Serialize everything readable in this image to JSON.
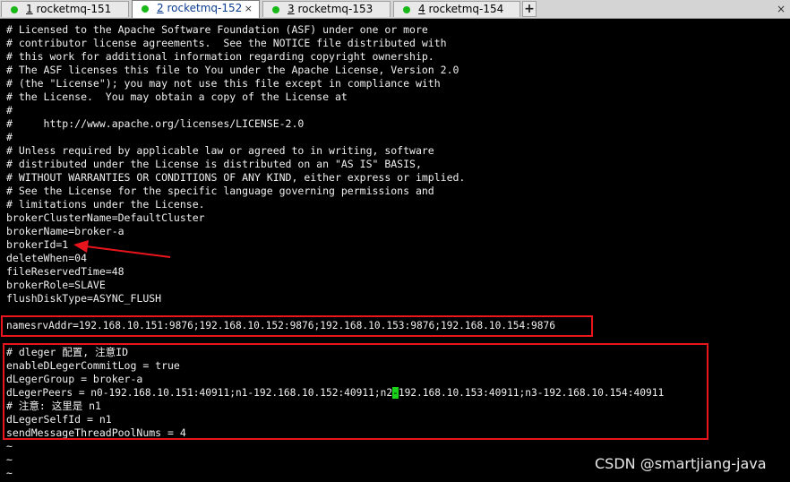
{
  "tabs": [
    {
      "number": "1",
      "title": "rocketmq-151"
    },
    {
      "number": "2",
      "title": "rocketmq-152"
    },
    {
      "number": "3",
      "title": "rocketmq-153"
    },
    {
      "number": "4",
      "title": "rocketmq-154"
    }
  ],
  "tabbar": {
    "add_label": "+",
    "close_label": "×"
  },
  "terminal": {
    "lines": [
      "# Licensed to the Apache Software Foundation (ASF) under one or more",
      "# contributor license agreements.  See the NOTICE file distributed with",
      "# this work for additional information regarding copyright ownership.",
      "# The ASF licenses this file to You under the Apache License, Version 2.0",
      "# (the \"License\"); you may not use this file except in compliance with",
      "# the License.  You may obtain a copy of the License at",
      "#",
      "#     http://www.apache.org/licenses/LICENSE-2.0",
      "#",
      "# Unless required by applicable law or agreed to in writing, software",
      "# distributed under the License is distributed on an \"AS IS\" BASIS,",
      "# WITHOUT WARRANTIES OR CONDITIONS OF ANY KIND, either express or implied.",
      "# See the License for the specific language governing permissions and",
      "# limitations under the License.",
      "brokerClusterName=DefaultCluster",
      "brokerName=broker-a",
      "brokerId=1",
      "deleteWhen=04",
      "fileReservedTime=48",
      "brokerRole=SLAVE",
      "flushDiskType=ASYNC_FLUSH",
      "",
      "namesrvAddr=192.168.10.151:9876;192.168.10.152:9876;192.168.10.153:9876;192.168.10.154:9876",
      "",
      "# dleger 配置, 注意ID",
      "enableDLegerCommitLog = true",
      "dLegerGroup = broker-a",
      "dLegerPeers = n0-192.168.10.151:40911;n1-192.168.10.152:40911;n2",
      "# 注意: 这里是 n1",
      "dLegerSelfId = n1",
      "sendMessageThreadPoolNums = 4",
      "~",
      "~",
      "~"
    ],
    "cursor_char": "-",
    "peers_rest": "192.168.10.153:40911;n3-192.168.10.154:40911"
  },
  "watermark": "CSDN @smartjiang-java",
  "colors": {
    "highlight_box": "#e8151c",
    "cursor": "#19d219",
    "status_dot": "#18b818"
  }
}
